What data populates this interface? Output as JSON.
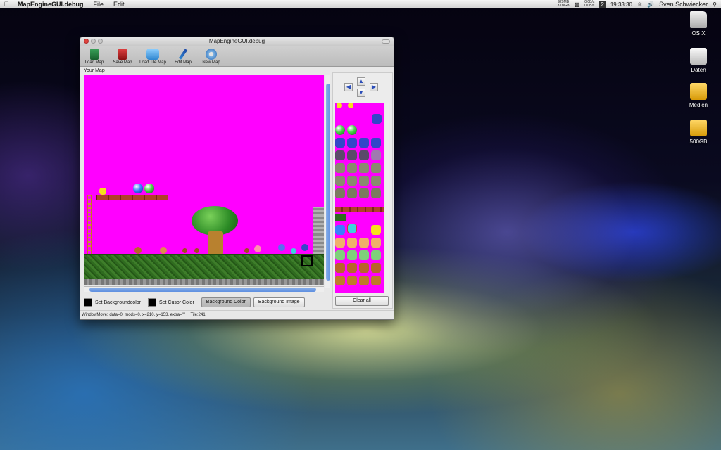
{
  "menubar": {
    "app_name": "MapEngineGUI.debug",
    "menus": [
      "File",
      "Edit"
    ],
    "ram_top": "929MB",
    "ram_bottom": "3.09GB",
    "net_top": "0.0B/s",
    "net_bottom": "0.0B/s",
    "spaces_number": "2",
    "clock": "19:33:30",
    "user_name": "Sven Schwiecker"
  },
  "desktop_icons": [
    {
      "label": "OS X",
      "icon": "hard-drive-icon",
      "color": "#d9d9d9"
    },
    {
      "label": "Daten",
      "icon": "hard-drive-icon",
      "color": "#e6e6e6"
    },
    {
      "label": "Medien",
      "icon": "external-drive-icon",
      "color": "#f0b81a"
    },
    {
      "label": "500GB",
      "icon": "external-drive-icon",
      "color": "#f0b81a"
    }
  ],
  "window": {
    "title": "MapEngineGUI.debug",
    "toolbar": {
      "load_map": "Load Map",
      "save_map": "Save Map",
      "load_tile_map": "Load Tile Map",
      "edit_map": "Edit Map",
      "new_map": "New Map"
    },
    "section_title": "Your Map",
    "controls": {
      "set_background_color": "Set Backgroundcolor",
      "set_cursor_color": "Set Cusor Color",
      "background_color_button": "Background Color",
      "background_image_button": "Background Image"
    },
    "clear_all": "Clear all",
    "status": "WindowMove: data=0, mods=0, x=210, y=153, extra=\"\"",
    "tile_status": "Tile:241"
  },
  "colors": {
    "map_background": "#ff00ff",
    "cursor_color": "#000000",
    "scroll_thumb": "#5e8fe0"
  }
}
